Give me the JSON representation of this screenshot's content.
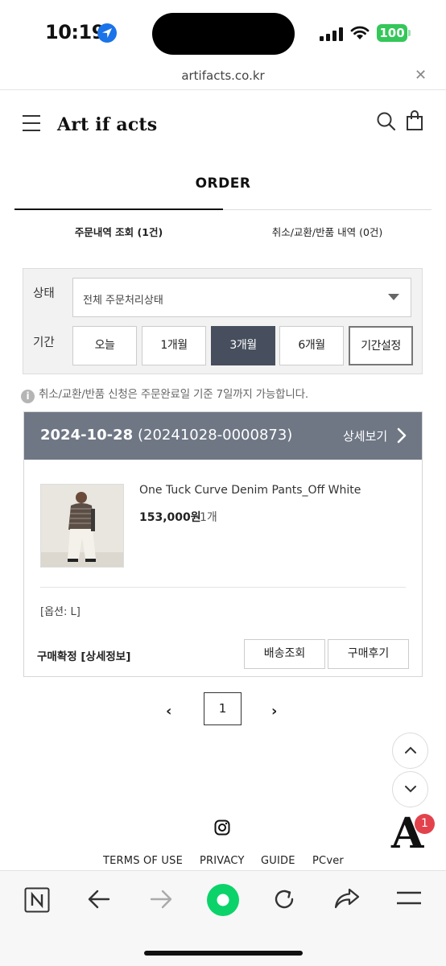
{
  "status_bar": {
    "time": "10:19",
    "battery": "100"
  },
  "browser": {
    "url": "artifacts.co.kr",
    "close_icon": "close-icon"
  },
  "site": {
    "logo": "Art if acts"
  },
  "page": {
    "title": "ORDER"
  },
  "tabs": [
    {
      "label": "주문내역 조회 (1건)",
      "active": true
    },
    {
      "label": "취소/교환/반품 내역 (0건)",
      "active": false
    }
  ],
  "filter": {
    "status_label": "상태",
    "status_value": "전체 주문처리상태",
    "period_label": "기간",
    "periods": [
      "오늘",
      "1개월",
      "3개월",
      "6개월",
      "기간설정"
    ],
    "active_period": "3개월"
  },
  "notice": "취소/교환/반품 신청은 주문완료일 기준 7일까지 가능합니다.",
  "order": {
    "date": "2024-10-28",
    "number": "(20241028-0000873)",
    "detail_link": "상세보기",
    "product_name": "One Tuck Curve Denim Pants_Off White",
    "price": "153,000원",
    "quantity": "1개",
    "option": "[옵션: L]",
    "status": "구매확정 [상세정보]",
    "buttons": [
      "배송조회",
      "구매후기"
    ]
  },
  "pagination": {
    "current": "1",
    "prev": "‹",
    "next": "›"
  },
  "footer": {
    "badge_count": "1",
    "links": [
      "TERMS OF USE",
      "PRIVACY",
      "GUIDE",
      "PCver"
    ]
  },
  "colors": {
    "order_header": "#6f7785",
    "active_period": "#474f5e",
    "toolbar_green": "#0bd36a",
    "badge": "#e3424d"
  }
}
